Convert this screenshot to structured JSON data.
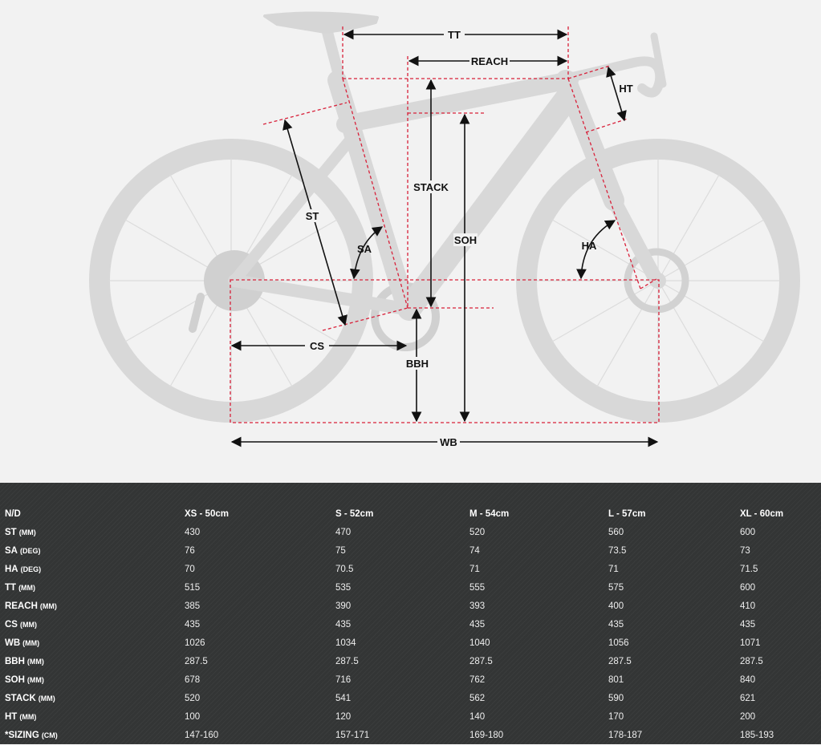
{
  "diagram": {
    "labels": {
      "tt": "TT",
      "reach": "REACH",
      "ht": "HT",
      "st": "ST",
      "stack": "STACK",
      "sa": "SA",
      "soh": "SOH",
      "ha": "HA",
      "cs": "CS",
      "bbh": "BBH",
      "wb": "WB"
    },
    "colors": {
      "frame": "#d8d8d8",
      "guide": "#d8213a",
      "arrow": "#111111"
    }
  },
  "table": {
    "headers": [
      "N/D",
      "XS - 50cm",
      "S - 52cm",
      "M - 54cm",
      "L - 57cm",
      "XL - 60cm"
    ],
    "rows": [
      {
        "param": "ST",
        "unit": "(MM)",
        "values": [
          "430",
          "470",
          "520",
          "560",
          "600"
        ]
      },
      {
        "param": "SA",
        "unit": "(DEG)",
        "values": [
          "76",
          "75",
          "74",
          "73.5",
          "73"
        ]
      },
      {
        "param": "HA",
        "unit": "(DEG)",
        "values": [
          "70",
          "70.5",
          "71",
          "71",
          "71.5"
        ]
      },
      {
        "param": "TT",
        "unit": "(MM)",
        "values": [
          "515",
          "535",
          "555",
          "575",
          "600"
        ]
      },
      {
        "param": "REACH",
        "unit": "(MM)",
        "values": [
          "385",
          "390",
          "393",
          "400",
          "410"
        ]
      },
      {
        "param": "CS",
        "unit": "(MM)",
        "values": [
          "435",
          "435",
          "435",
          "435",
          "435"
        ]
      },
      {
        "param": "WB",
        "unit": "(MM)",
        "values": [
          "1026",
          "1034",
          "1040",
          "1056",
          "1071"
        ]
      },
      {
        "param": "BBH",
        "unit": "(MM)",
        "values": [
          "287.5",
          "287.5",
          "287.5",
          "287.5",
          "287.5"
        ]
      },
      {
        "param": "SOH",
        "unit": "(MM)",
        "values": [
          "678",
          "716",
          "762",
          "801",
          "840"
        ]
      },
      {
        "param": "STACK",
        "unit": "(MM)",
        "values": [
          "520",
          "541",
          "562",
          "590",
          "621"
        ]
      },
      {
        "param": "HT",
        "unit": "(MM)",
        "values": [
          "100",
          "120",
          "140",
          "170",
          "200"
        ]
      },
      {
        "param": "*SIZING",
        "unit": "(CM)",
        "values": [
          "147-160",
          "157-171",
          "169-180",
          "178-187",
          "185-193"
        ]
      }
    ]
  }
}
